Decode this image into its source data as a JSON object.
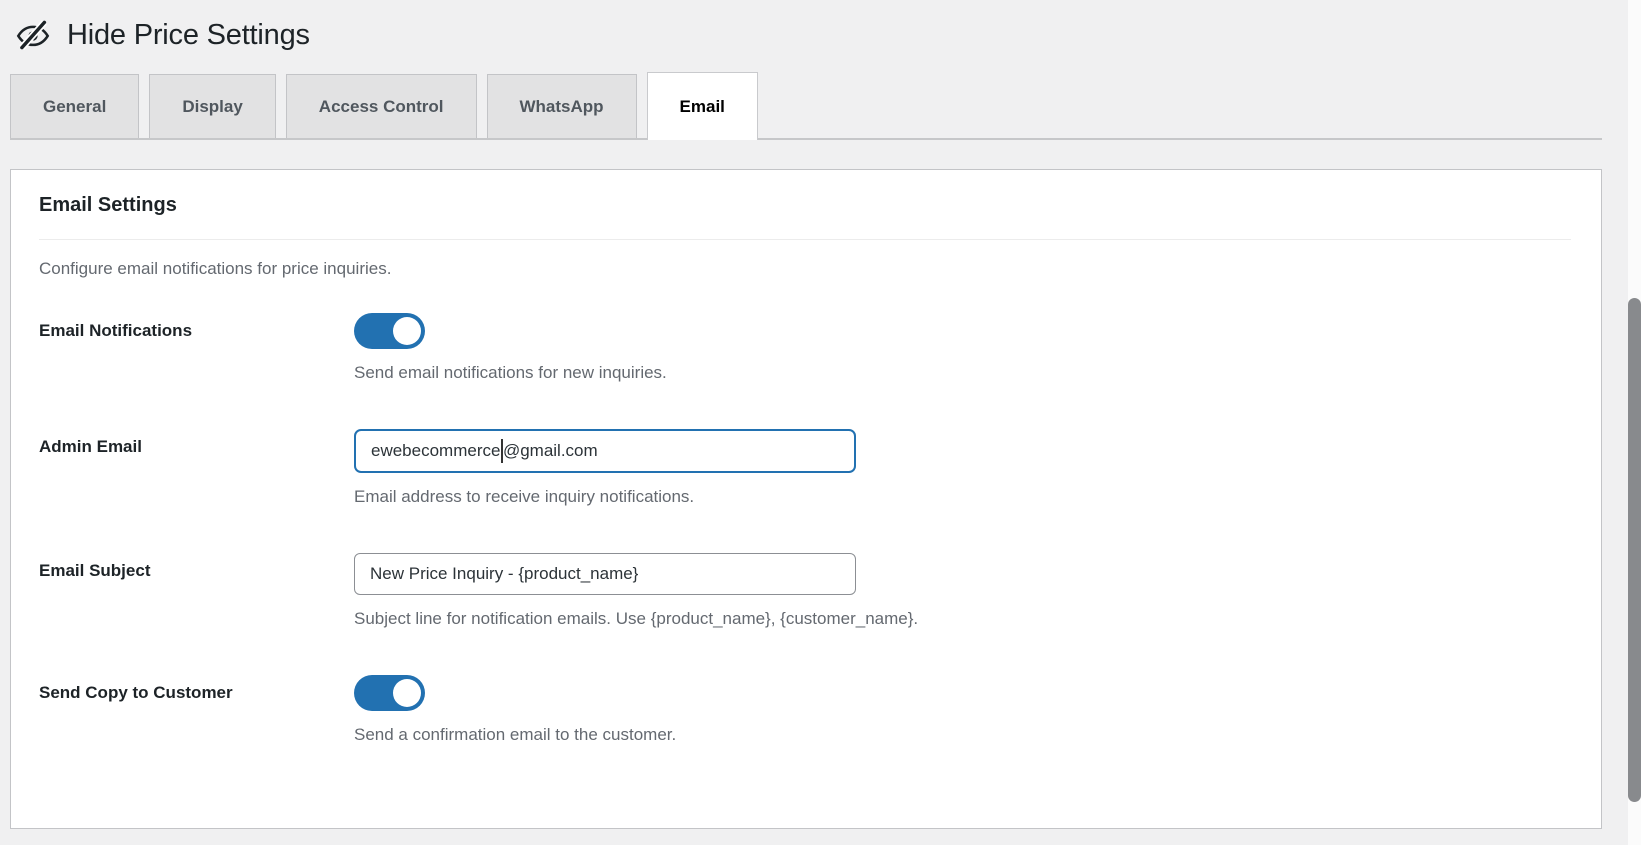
{
  "window": {
    "title": "Hide Price Settings",
    "icon": "eye-slash"
  },
  "tabs": {
    "items": [
      {
        "label": "General",
        "active": false
      },
      {
        "label": "Display",
        "active": false
      },
      {
        "label": "Access Control",
        "active": false
      },
      {
        "label": "WhatsApp",
        "active": false
      },
      {
        "label": "Email",
        "active": true
      }
    ]
  },
  "panel": {
    "heading": "Email Settings",
    "intro": "Configure email notifications for price inquiries.",
    "fields": [
      {
        "type": "toggle",
        "label": "Email Notifications",
        "state": "on",
        "help": "Send email notifications for new inquiries."
      },
      {
        "type": "text",
        "label": "Admin Email",
        "value": "ewebecommerce@gmail.com",
        "value_before_caret": "ewebecommerce",
        "value_after_caret": "@gmail.com",
        "focused": true,
        "help": "Email address to receive inquiry notifications."
      },
      {
        "type": "text",
        "label": "Email Subject",
        "value": "New Price Inquiry - {product_name}",
        "focused": false,
        "help": "Subject line for notification emails. Use {product_name}, {customer_name}."
      },
      {
        "type": "toggle",
        "label": "Send Copy to Customer",
        "state": "on",
        "help": "Send a confirmation email to the customer."
      }
    ]
  },
  "colors": {
    "accent_blue": "#2271b1",
    "page_background": "#f0f0f1",
    "card_border": "#c3c4c7",
    "muted_text": "#646970"
  }
}
